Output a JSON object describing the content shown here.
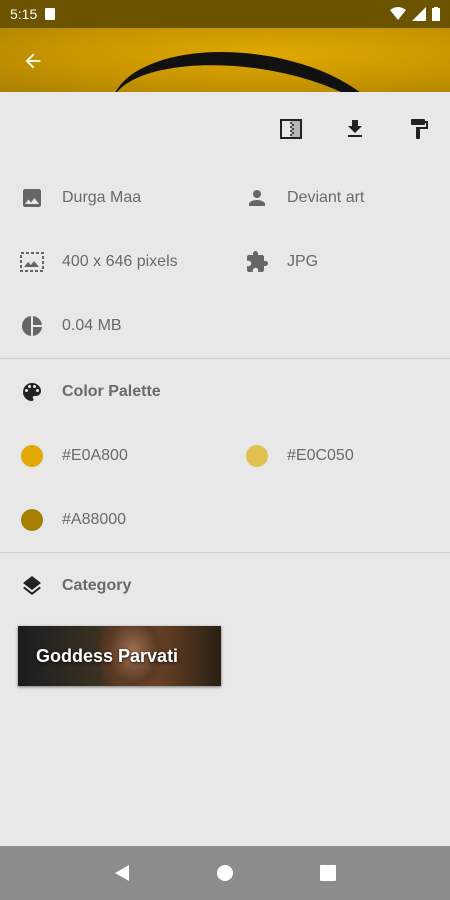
{
  "status_bar": {
    "time": "5:15"
  },
  "header": {
    "back_icon": "arrow-back-icon"
  },
  "toolbar": {
    "icons": [
      "set-wallpaper-icon",
      "download-icon",
      "paint-roller-icon"
    ]
  },
  "info": {
    "title": "Durga Maa",
    "author": "Deviant art",
    "resolution": "400 x 646 pixels",
    "format": "JPG",
    "size": "0.04 MB"
  },
  "palette": {
    "heading": "Color Palette",
    "colors": [
      {
        "hex": "#E0A800",
        "label": "#E0A800"
      },
      {
        "hex": "#E0C050",
        "label": "#E0C050"
      },
      {
        "hex": "#A88000",
        "label": "#A88000"
      }
    ]
  },
  "category": {
    "heading": "Category",
    "items": [
      {
        "label": "Goddess Parvati"
      }
    ]
  }
}
